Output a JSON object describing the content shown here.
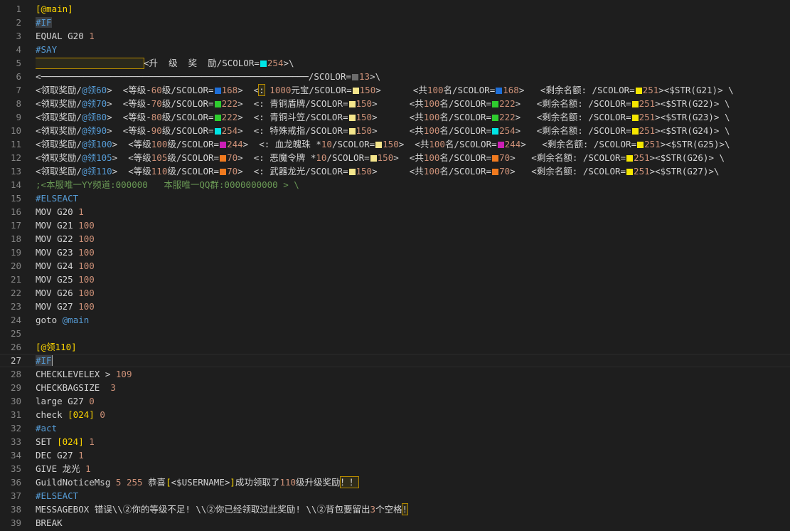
{
  "editor": {
    "current_line": 27,
    "lines": [
      {
        "num": "1",
        "segs": [
          {
            "t": "[@main]",
            "c": "bracket"
          }
        ]
      },
      {
        "num": "2",
        "segs": [
          {
            "t": "#IF",
            "c": "kw",
            "hl": "sel"
          }
        ]
      },
      {
        "num": "3",
        "segs": [
          {
            "t": "EQUAL G20 ",
            "c": "default"
          },
          {
            "t": "1",
            "c": "num"
          }
        ]
      },
      {
        "num": "4",
        "segs": [
          {
            "t": "#SAY",
            "c": "kw"
          }
        ]
      },
      {
        "num": "5",
        "segs": [
          {
            "box": true
          },
          {
            "t": "<升  级  奖  励/SCOLOR=",
            "c": "default"
          },
          {
            "sw": "#00e5e5"
          },
          {
            "t": "254",
            "c": "num"
          },
          {
            "t": ">\\",
            "c": "default"
          }
        ]
      },
      {
        "num": "6",
        "segs": [
          {
            "t": "<──────────────────────────────────────────────────/SCOLOR=",
            "c": "default"
          },
          {
            "sw": "#6b6b6b"
          },
          {
            "t": "13",
            "c": "num"
          },
          {
            "t": ">\\",
            "c": "default"
          }
        ]
      },
      {
        "num": "7",
        "segs": [
          {
            "t": "<领取奖励/",
            "c": "default"
          },
          {
            "t": "@领60",
            "c": "kw"
          },
          {
            "t": ">  <等级-",
            "c": "default"
          },
          {
            "t": "60",
            "c": "num"
          },
          {
            "t": "级/SCOLOR=",
            "c": "default"
          },
          {
            "sw": "#1e6fd9"
          },
          {
            "t": "168",
            "c": "num"
          },
          {
            "t": ">  <",
            "c": "default"
          },
          {
            "t": ":",
            "c": "default",
            "hl": "box"
          },
          {
            "t": " 1000",
            "c": "num"
          },
          {
            "t": "元宝/SCOLOR=",
            "c": "default"
          },
          {
            "sw": "#f5e68c"
          },
          {
            "t": "150",
            "c": "num"
          },
          {
            "t": ">      <共",
            "c": "default"
          },
          {
            "t": "100",
            "c": "num"
          },
          {
            "t": "名/SCOLOR=",
            "c": "default"
          },
          {
            "sw": "#1e6fd9"
          },
          {
            "t": "168",
            "c": "num"
          },
          {
            "t": ">   <剩余名额: /SCOLOR=",
            "c": "default"
          },
          {
            "sw": "#f5e600"
          },
          {
            "t": "251",
            "c": "num"
          },
          {
            "t": "><$STR(G21)> \\",
            "c": "default"
          }
        ]
      },
      {
        "num": "8",
        "segs": [
          {
            "t": "<领取奖励/",
            "c": "default"
          },
          {
            "t": "@领70",
            "c": "kw"
          },
          {
            "t": ">  <等级-",
            "c": "default"
          },
          {
            "t": "70",
            "c": "num"
          },
          {
            "t": "级/SCOLOR=",
            "c": "default"
          },
          {
            "sw": "#2ecc2e"
          },
          {
            "t": "222",
            "c": "num"
          },
          {
            "t": ">  <: 青铜盾牌/SCOLOR=",
            "c": "default"
          },
          {
            "sw": "#f5e68c"
          },
          {
            "t": "150",
            "c": "num"
          },
          {
            "t": ">      <共",
            "c": "default"
          },
          {
            "t": "100",
            "c": "num"
          },
          {
            "t": "名/SCOLOR=",
            "c": "default"
          },
          {
            "sw": "#2ecc2e"
          },
          {
            "t": "222",
            "c": "num"
          },
          {
            "t": ">   <剩余名额: /SCOLOR=",
            "c": "default"
          },
          {
            "sw": "#f5e600"
          },
          {
            "t": "251",
            "c": "num"
          },
          {
            "t": "><$STR(G22)> \\",
            "c": "default"
          }
        ]
      },
      {
        "num": "9",
        "segs": [
          {
            "t": "<领取奖励/",
            "c": "default"
          },
          {
            "t": "@领80",
            "c": "kw"
          },
          {
            "t": ">  <等级-",
            "c": "default"
          },
          {
            "t": "80",
            "c": "num"
          },
          {
            "t": "级/SCOLOR=",
            "c": "default"
          },
          {
            "sw": "#2ecc2e"
          },
          {
            "t": "222",
            "c": "num"
          },
          {
            "t": ">  <: 青铜斗笠/SCOLOR=",
            "c": "default"
          },
          {
            "sw": "#f5e68c"
          },
          {
            "t": "150",
            "c": "num"
          },
          {
            "t": ">      <共",
            "c": "default"
          },
          {
            "t": "100",
            "c": "num"
          },
          {
            "t": "名/SCOLOR=",
            "c": "default"
          },
          {
            "sw": "#2ecc2e"
          },
          {
            "t": "222",
            "c": "num"
          },
          {
            "t": ">   <剩余名额: /SCOLOR=",
            "c": "default"
          },
          {
            "sw": "#f5e600"
          },
          {
            "t": "251",
            "c": "num"
          },
          {
            "t": "><$STR(G23)> \\",
            "c": "default"
          }
        ]
      },
      {
        "num": "10",
        "segs": [
          {
            "t": "<领取奖励/",
            "c": "default"
          },
          {
            "t": "@领90",
            "c": "kw"
          },
          {
            "t": ">  <等级-",
            "c": "default"
          },
          {
            "t": "90",
            "c": "num"
          },
          {
            "t": "级/SCOLOR=",
            "c": "default"
          },
          {
            "sw": "#00e5e5"
          },
          {
            "t": "254",
            "c": "num"
          },
          {
            "t": ">  <: 特殊戒指/SCOLOR=",
            "c": "default"
          },
          {
            "sw": "#f5e68c"
          },
          {
            "t": "150",
            "c": "num"
          },
          {
            "t": ">      <共",
            "c": "default"
          },
          {
            "t": "100",
            "c": "num"
          },
          {
            "t": "名/SCOLOR=",
            "c": "default"
          },
          {
            "sw": "#00e5e5"
          },
          {
            "t": "254",
            "c": "num"
          },
          {
            "t": ">   <剩余名额: /SCOLOR=",
            "c": "default"
          },
          {
            "sw": "#f5e600"
          },
          {
            "t": "251",
            "c": "num"
          },
          {
            "t": "><$STR(G24)> \\",
            "c": "default"
          }
        ]
      },
      {
        "num": "11",
        "segs": [
          {
            "t": "<领取奖励/",
            "c": "default"
          },
          {
            "t": "@领100",
            "c": "kw"
          },
          {
            "t": ">  <等级",
            "c": "default"
          },
          {
            "t": "100",
            "c": "num"
          },
          {
            "t": "级/SCOLOR=",
            "c": "default"
          },
          {
            "sw": "#cc1fb5"
          },
          {
            "t": "244",
            "c": "num"
          },
          {
            "t": ">  <: 血龙魄珠 *",
            "c": "default"
          },
          {
            "t": "10",
            "c": "num"
          },
          {
            "t": "/SCOLOR=",
            "c": "default"
          },
          {
            "sw": "#f5e68c"
          },
          {
            "t": "150",
            "c": "num"
          },
          {
            "t": ">  <共",
            "c": "default"
          },
          {
            "t": "100",
            "c": "num"
          },
          {
            "t": "名/SCOLOR=",
            "c": "default"
          },
          {
            "sw": "#cc1fb5"
          },
          {
            "t": "244",
            "c": "num"
          },
          {
            "t": ">   <剩余名额: /SCOLOR=",
            "c": "default"
          },
          {
            "sw": "#f5e600"
          },
          {
            "t": "251",
            "c": "num"
          },
          {
            "t": "><$STR(G25)>\\",
            "c": "default"
          }
        ]
      },
      {
        "num": "12",
        "segs": [
          {
            "t": "<领取奖励/",
            "c": "default"
          },
          {
            "t": "@领105",
            "c": "kw"
          },
          {
            "t": ">  <等级",
            "c": "default"
          },
          {
            "t": "105",
            "c": "num"
          },
          {
            "t": "级/SCOLOR=",
            "c": "default"
          },
          {
            "sw": "#f07a1f"
          },
          {
            "t": "70",
            "c": "num"
          },
          {
            "t": ">  <: 恶魔令牌 *",
            "c": "default"
          },
          {
            "t": "10",
            "c": "num"
          },
          {
            "t": "/SCOLOR=",
            "c": "default"
          },
          {
            "sw": "#f5e68c"
          },
          {
            "t": "150",
            "c": "num"
          },
          {
            "t": ">  <共",
            "c": "default"
          },
          {
            "t": "100",
            "c": "num"
          },
          {
            "t": "名/SCOLOR=",
            "c": "default"
          },
          {
            "sw": "#f07a1f"
          },
          {
            "t": "70",
            "c": "num"
          },
          {
            "t": ">   <剩余名额: /SCOLOR=",
            "c": "default"
          },
          {
            "sw": "#f5e600"
          },
          {
            "t": "251",
            "c": "num"
          },
          {
            "t": "><$STR(G26)> \\",
            "c": "default"
          }
        ]
      },
      {
        "num": "13",
        "segs": [
          {
            "t": "<领取奖励/",
            "c": "default"
          },
          {
            "t": "@领110",
            "c": "kw"
          },
          {
            "t": ">  <等级",
            "c": "default"
          },
          {
            "t": "110",
            "c": "num"
          },
          {
            "t": "级/SCOLOR=",
            "c": "default"
          },
          {
            "sw": "#f07a1f"
          },
          {
            "t": "70",
            "c": "num"
          },
          {
            "t": ">  <: 武器龙光/SCOLOR=",
            "c": "default"
          },
          {
            "sw": "#f5e68c"
          },
          {
            "t": "150",
            "c": "num"
          },
          {
            "t": ">      <共",
            "c": "default"
          },
          {
            "t": "100",
            "c": "num"
          },
          {
            "t": "名/SCOLOR=",
            "c": "default"
          },
          {
            "sw": "#f07a1f"
          },
          {
            "t": "70",
            "c": "num"
          },
          {
            "t": ">   <剩余名额: /SCOLOR=",
            "c": "default"
          },
          {
            "sw": "#f5e600"
          },
          {
            "t": "251",
            "c": "num"
          },
          {
            "t": "><$STR(G27)>\\",
            "c": "default"
          }
        ]
      },
      {
        "num": "14",
        "segs": [
          {
            "t": ";<本服唯一YY频道:000000   本服唯一QQ群:0000000000 > \\",
            "c": "comment"
          }
        ]
      },
      {
        "num": "15",
        "segs": [
          {
            "t": "#ELSEACT",
            "c": "kw"
          }
        ]
      },
      {
        "num": "16",
        "segs": [
          {
            "t": "MOV G20 ",
            "c": "default"
          },
          {
            "t": "1",
            "c": "num"
          }
        ]
      },
      {
        "num": "17",
        "segs": [
          {
            "t": "MOV G21 ",
            "c": "default"
          },
          {
            "t": "100",
            "c": "num"
          }
        ]
      },
      {
        "num": "18",
        "segs": [
          {
            "t": "MOV G22 ",
            "c": "default"
          },
          {
            "t": "100",
            "c": "num"
          }
        ]
      },
      {
        "num": "19",
        "segs": [
          {
            "t": "MOV G23 ",
            "c": "default"
          },
          {
            "t": "100",
            "c": "num"
          }
        ]
      },
      {
        "num": "20",
        "segs": [
          {
            "t": "MOV G24 ",
            "c": "default"
          },
          {
            "t": "100",
            "c": "num"
          }
        ]
      },
      {
        "num": "21",
        "segs": [
          {
            "t": "MOV G25 ",
            "c": "default"
          },
          {
            "t": "100",
            "c": "num"
          }
        ]
      },
      {
        "num": "22",
        "segs": [
          {
            "t": "MOV G26 ",
            "c": "default"
          },
          {
            "t": "100",
            "c": "num"
          }
        ]
      },
      {
        "num": "23",
        "segs": [
          {
            "t": "MOV G27 ",
            "c": "default"
          },
          {
            "t": "100",
            "c": "num"
          }
        ]
      },
      {
        "num": "24",
        "segs": [
          {
            "t": "goto ",
            "c": "default"
          },
          {
            "t": "@main",
            "c": "kw"
          }
        ]
      },
      {
        "num": "25",
        "segs": []
      },
      {
        "num": "26",
        "segs": [
          {
            "t": "[@领110]",
            "c": "bracket"
          }
        ]
      },
      {
        "num": "27",
        "segs": [
          {
            "t": "#IF",
            "c": "kw",
            "hl": "sel"
          },
          {
            "cursor": true
          }
        ]
      },
      {
        "num": "28",
        "segs": [
          {
            "t": "CHECKLEVELEX > ",
            "c": "default"
          },
          {
            "t": "109",
            "c": "num"
          }
        ]
      },
      {
        "num": "29",
        "segs": [
          {
            "t": "CHECKBAGSIZE  ",
            "c": "default"
          },
          {
            "t": "3",
            "c": "num"
          }
        ]
      },
      {
        "num": "30",
        "segs": [
          {
            "t": "large G27 ",
            "c": "default"
          },
          {
            "t": "0",
            "c": "num"
          }
        ]
      },
      {
        "num": "31",
        "segs": [
          {
            "t": "check ",
            "c": "default"
          },
          {
            "t": "[024]",
            "c": "bracket"
          },
          {
            "t": " ",
            "c": "default"
          },
          {
            "t": "0",
            "c": "num"
          }
        ]
      },
      {
        "num": "32",
        "segs": [
          {
            "t": "#act",
            "c": "kw"
          }
        ]
      },
      {
        "num": "33",
        "segs": [
          {
            "t": "SET ",
            "c": "default"
          },
          {
            "t": "[024]",
            "c": "bracket"
          },
          {
            "t": " ",
            "c": "default"
          },
          {
            "t": "1",
            "c": "num"
          }
        ]
      },
      {
        "num": "34",
        "segs": [
          {
            "t": "DEC G27 ",
            "c": "default"
          },
          {
            "t": "1",
            "c": "num"
          }
        ]
      },
      {
        "num": "35",
        "segs": [
          {
            "t": "GIVE 龙光 ",
            "c": "default"
          },
          {
            "t": "1",
            "c": "num"
          }
        ]
      },
      {
        "num": "36",
        "segs": [
          {
            "t": "GuildNoticeMsg ",
            "c": "default"
          },
          {
            "t": "5 255",
            "c": "num"
          },
          {
            "t": " 恭喜",
            "c": "default"
          },
          {
            "t": "[",
            "c": "bracket"
          },
          {
            "t": "<$USERNAME>",
            "c": "default"
          },
          {
            "t": "]",
            "c": "bracket"
          },
          {
            "t": "成功领取了",
            "c": "default"
          },
          {
            "t": "110",
            "c": "num"
          },
          {
            "t": "级升级奖励",
            "c": "default"
          },
          {
            "t": "！！",
            "c": "default",
            "hl": "box"
          }
        ]
      },
      {
        "num": "37",
        "segs": [
          {
            "t": "#ELSEACT",
            "c": "kw"
          }
        ]
      },
      {
        "num": "38",
        "segs": [
          {
            "t": "MESSAGEBOX 错误\\\\②你的等级不足! \\\\②你已经领取过此奖励! \\\\②背包要留出",
            "c": "default"
          },
          {
            "t": "3",
            "c": "num"
          },
          {
            "t": "个空格",
            "c": "default"
          },
          {
            "t": "!",
            "c": "default",
            "hl": "box"
          }
        ]
      },
      {
        "num": "39",
        "segs": [
          {
            "t": "BREAK",
            "c": "default"
          }
        ]
      }
    ]
  }
}
